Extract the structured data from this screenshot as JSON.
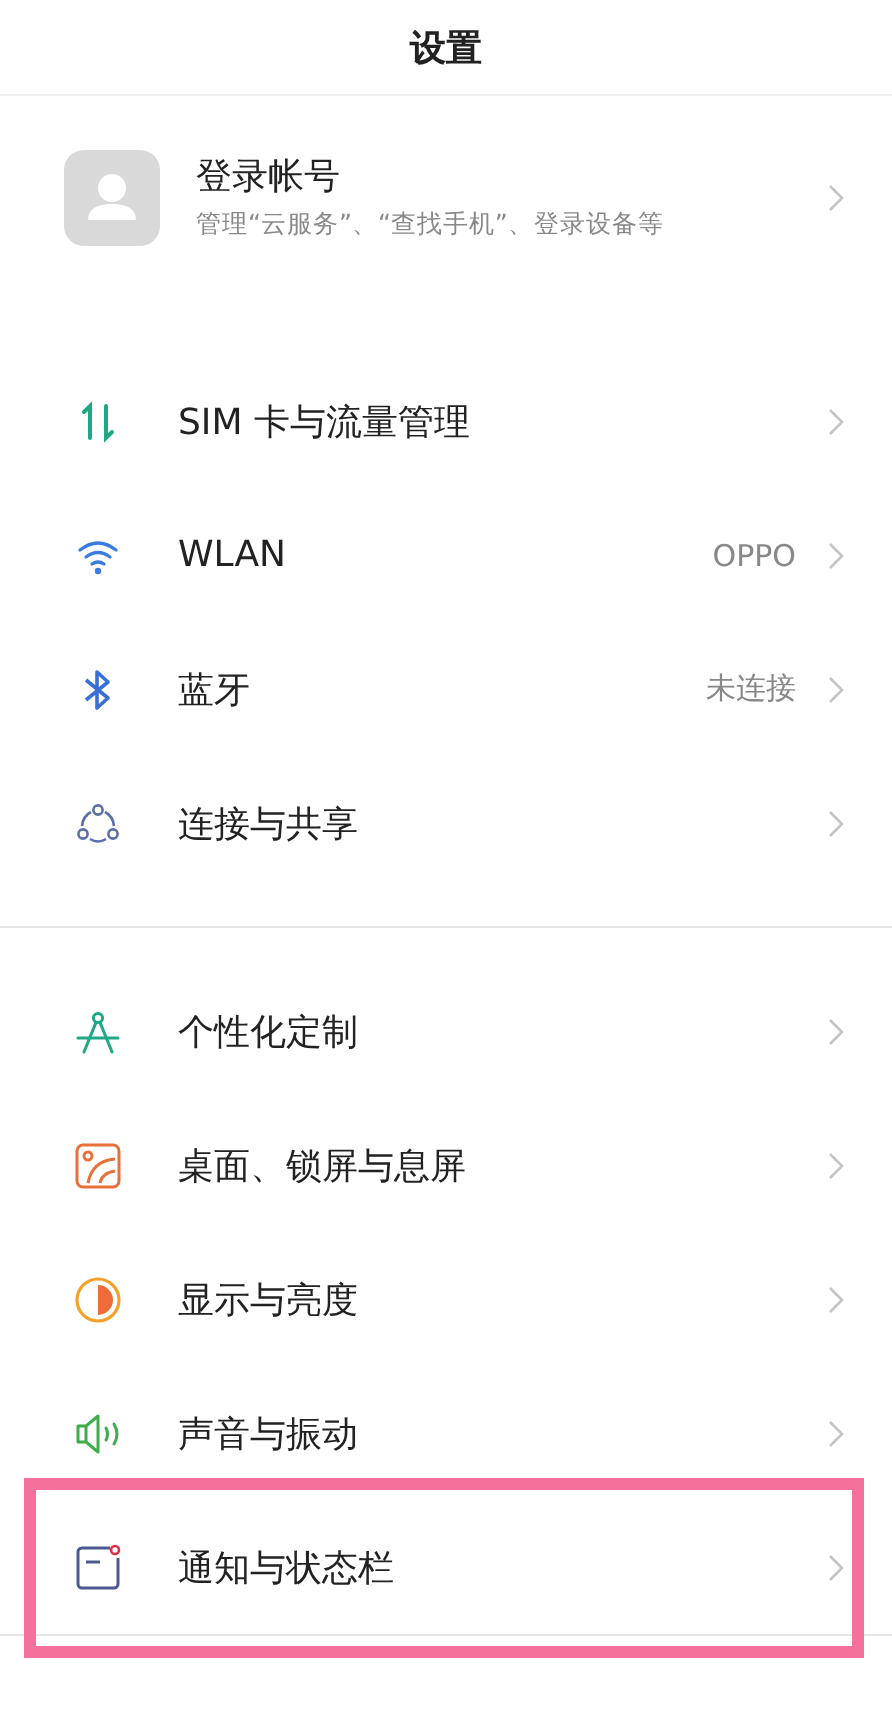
{
  "title": "设置",
  "account": {
    "name": "登录帐号",
    "subtitle": "管理“云服务”、“查找手机”、登录设备等"
  },
  "groups": [
    {
      "items": [
        {
          "kind": "sim",
          "label": "SIM 卡与流量管理",
          "highlighted": false
        },
        {
          "kind": "wifi",
          "label": "WLAN",
          "value": "OPPO",
          "highlighted": false
        },
        {
          "kind": "bluetooth",
          "label": "蓝牙",
          "value": "未连接",
          "highlighted": false
        },
        {
          "kind": "share",
          "label": "连接与共享",
          "highlighted": false
        }
      ]
    },
    {
      "items": [
        {
          "kind": "compass",
          "label": "个性化定制",
          "highlighted": false
        },
        {
          "kind": "wallpaper",
          "label": "桌面、锁屏与息屏",
          "highlighted": false
        },
        {
          "kind": "display",
          "label": "显示与亮度",
          "highlighted": false
        },
        {
          "kind": "sound",
          "label": "声音与振动",
          "highlighted": false
        },
        {
          "kind": "notification",
          "label": "通知与状态栏",
          "highlighted": true
        }
      ]
    }
  ]
}
